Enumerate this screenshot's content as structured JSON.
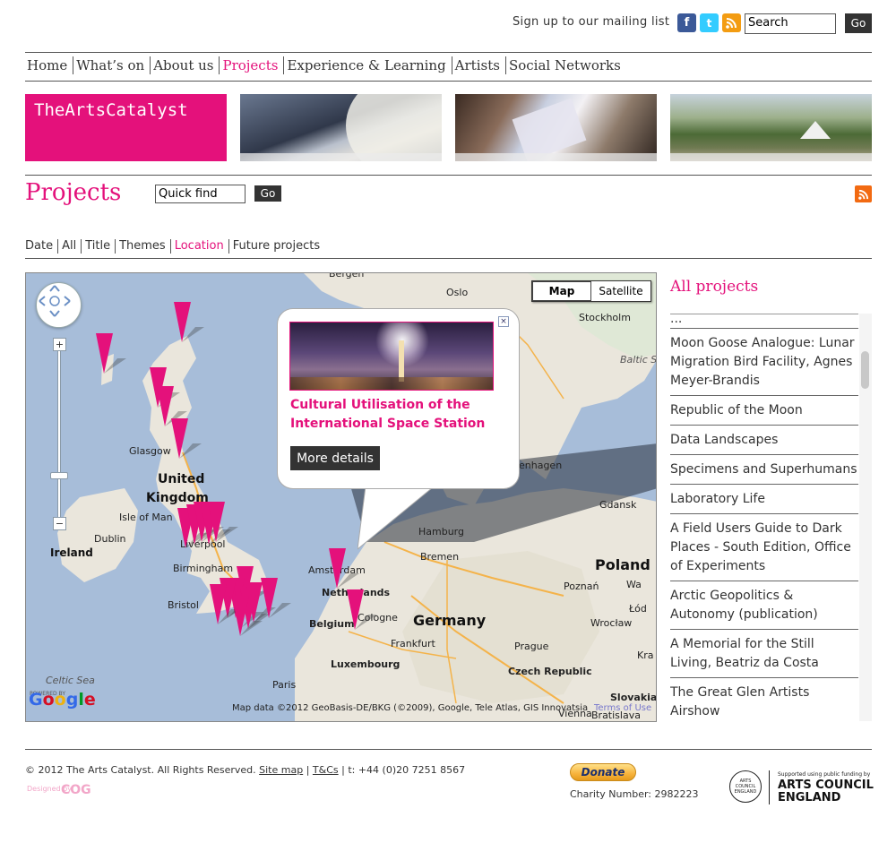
{
  "header": {
    "mailing_label": "Sign up to our mailing list",
    "icons": [
      "facebook-icon",
      "twitter-icon",
      "rss-icon"
    ],
    "search_value": "Search",
    "search_go": "Go"
  },
  "nav": {
    "items": [
      "Home",
      "What’s on",
      "About us",
      "Projects",
      "Experience & Learning",
      "Artists",
      "Social Networks"
    ],
    "active": "Projects"
  },
  "banner": {
    "logo": "TheArtsCatalyst"
  },
  "page": {
    "title": "Projects",
    "quick_find_value": "Quick find",
    "quick_go": "Go"
  },
  "subnav": {
    "items": [
      "Date",
      "All",
      "Title",
      "Themes",
      "Location",
      "Future projects"
    ],
    "active": "Location"
  },
  "map": {
    "type_buttons": [
      "Map",
      "Satellite"
    ],
    "active_type": "Map",
    "labels": {
      "bergen": "Bergen",
      "oslo": "Oslo",
      "stockholm": "Stockholm",
      "baltic": "Baltic Sea",
      "glasgow": "Glasgow",
      "uk1": "United",
      "uk2": "Kingdom",
      "isle": "Isle of Man",
      "dublin": "Dublin",
      "ireland": "Ireland",
      "liverpool": "Liverpool",
      "birmingham": "Birmingham",
      "bristol": "Bristol",
      "celtic": "Celtic Sea",
      "copenhagen": "enhagen",
      "gdansk": "Gdansk",
      "hamburg": "Hamburg",
      "bremen": "Bremen",
      "amsterdam": "Amsterdam",
      "netherlands": "Netherlands",
      "belgium": "Belgium",
      "cologne": "Cologne",
      "germany": "Germany",
      "poland": "Poland",
      "poznan": "Poznań",
      "wroclaw": "Wrocław",
      "warsaw": "Wa",
      "lodz": "Łód",
      "frankfurt": "Frankfurt",
      "prague": "Prague",
      "luxembourg": "Luxembourg",
      "czech": "Czech Republic",
      "paris": "Paris",
      "slovakia": "Slovakia",
      "vienna": "Vienna",
      "bratislava": "Bratislava",
      "kraj": "Kra"
    },
    "powered_by": "POWERED BY",
    "google": "Google",
    "attribution": "Map data ©2012 GeoBasis-DE/BKG (©2009), Google, Tele Atlas, GIS Innovatsia",
    "terms": "Terms of Use",
    "info_window": {
      "title": "Cultural Utilisation of the International Space Station",
      "more_button": "More details",
      "close": "×"
    },
    "marker_color": "#e4117b"
  },
  "sidebar": {
    "title": "All projects",
    "partial_item": "...",
    "items": [
      "Moon Goose Analogue: Lunar Migration Bird Facility, Agnes Meyer-Brandis",
      "Republic of the Moon",
      "Data Landscapes",
      "Specimens and Superhumans",
      "Laboratory Life",
      "A Field Users Guide to Dark Places - South Edition, Office of Experiments",
      "Arctic Geopolitics & Autonomy (publication)",
      "A Memorial for the Still Living, Beatriz da Costa",
      "The Great Glen Artists Airshow"
    ]
  },
  "footer": {
    "copyright": "© 2012 The Arts Catalyst. All Rights Reserved.",
    "sitemap": "Site map",
    "sep1": " | ",
    "tcs": "T&Cs",
    "phone": " | t: +44 (0)20 7251 8567",
    "designed_by": "Designed by",
    "cog": "COG",
    "donate": "Donate",
    "charity": "Charity Number: 2982223",
    "ace_seal": "ARTS COUNCIL ENGLAND",
    "ace_small": "Supported using public funding by",
    "ace_big": "ARTS COUNCIL ENGLAND"
  },
  "colors": {
    "accent": "#e4117b",
    "text": "#333333",
    "button": "#333333"
  }
}
